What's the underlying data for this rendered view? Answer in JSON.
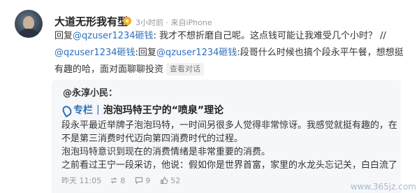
{
  "post": {
    "username": "大道无形我有型",
    "meta": "3小时前 · 来自iPhone",
    "reply": {
      "prefix": "回复",
      "mention1": "@qzuser1234砸钱",
      "text1": ": 我才不想折磨自己呢。这点钱可能让我难受几个小时？ // ",
      "mention2": "@qzuser1234砸钱",
      "text2": ":回复",
      "mention3": "@qzuser1234砸钱",
      "text3": ":段哥什么时候也搞个段永平午餐，想想挺有趣的哈，面对面聊聊投资",
      "view_conversation": "查看对话"
    }
  },
  "quote": {
    "author": "@永淳小民：",
    "column_label": "专栏",
    "divider": "|",
    "article_title": "泡泡玛特王宁的“喷泉”理论",
    "lines": [
      "段永平最近举牌子泡泡玛特，一时间另很多人觉得非常惊讶。我感觉就挺有趣的，在想是",
      "不是第三消费时代迈向第四消费时代的过程。",
      "泡泡玛特意识到现在的消费情绪是非常重要的消费。",
      "之前看过王宁一段采访，他说：假如你是世界首富，家里的水龙头忘记关，白白流了一..."
    ],
    "time": "昨天 11:05",
    "reposts": "8",
    "comments": "9",
    "likes": "52"
  },
  "watermark": "www.365jz.com",
  "colors": {
    "link": "#2c6fbf",
    "meta": "#999999",
    "card_bg": "#f6f7f9"
  },
  "icons": [
    "vip-badge-icon",
    "column-icon",
    "repost-icon",
    "comment-icon",
    "like-icon"
  ]
}
